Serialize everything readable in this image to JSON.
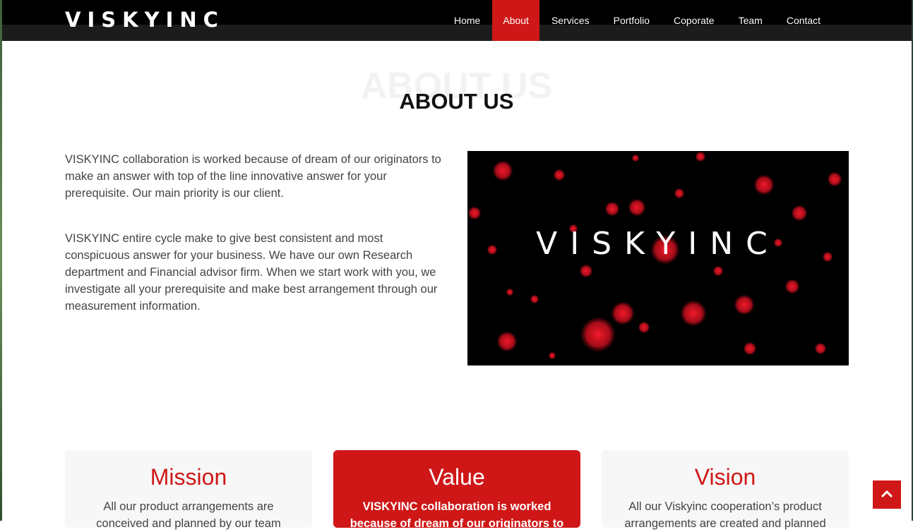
{
  "brand": {
    "logo": "VISKYINC",
    "accent": "#cf1717"
  },
  "nav": {
    "items": [
      {
        "label": "Home",
        "active": false
      },
      {
        "label": "About",
        "active": true
      },
      {
        "label": "Services",
        "active": false
      },
      {
        "label": "Portfolio",
        "active": false
      },
      {
        "label": "Coporate",
        "active": false
      },
      {
        "label": "Team",
        "active": false
      },
      {
        "label": "Contact",
        "active": false
      }
    ]
  },
  "about": {
    "heading_bg": "ABOUT US",
    "heading": "ABOUT US",
    "paragraphs": [
      "VISKYINC collaboration is worked because of dream of our originators to make an answer with top of the line innovative answer for your prerequisite. Our main priority is our client.",
      "VISKYINC entire cycle make to give best consistent and most conspicuous answer for your business. We have our own Research department and Financial advisor firm. When we start work with you, we investigate all your prerequisite and make best arrangement through our measurement information."
    ],
    "image_text": "VISKYINC"
  },
  "cards": [
    {
      "title": "Mission",
      "text": "All our product arrangements are",
      "text2": "conceived and planned by our team",
      "highlight": false
    },
    {
      "title": "Value",
      "text": "VISKYINC collaboration is worked",
      "text2": "because of dream of our originators to",
      "highlight": true
    },
    {
      "title": "Vision",
      "text": "All our Viskyinc cooperation’s product",
      "text2": "arrangements are created and planned",
      "highlight": false
    }
  ],
  "scroll_top_icon": "chevron-up-icon"
}
